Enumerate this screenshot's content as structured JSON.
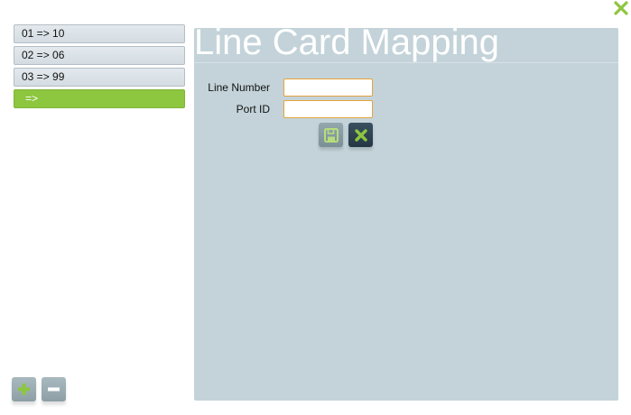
{
  "mappings": [
    {
      "label": "01 => 10"
    },
    {
      "label": "02 => 06"
    },
    {
      "label": "03 => 99"
    },
    {
      "label": "=>"
    }
  ],
  "panel": {
    "title": "Line Card Mapping",
    "line_number_label": "Line Number",
    "line_number_value": "",
    "port_id_label": "Port ID",
    "port_id_value": ""
  },
  "icons": {
    "close": "close-icon",
    "save": "floppy-disk-icon",
    "cancel": "x-icon",
    "add": "plus-icon",
    "remove": "minus-icon"
  },
  "colors": {
    "accent_green": "#8dc63f",
    "panel_background": "#c3d3d9",
    "input_border": "#e8a33a"
  }
}
